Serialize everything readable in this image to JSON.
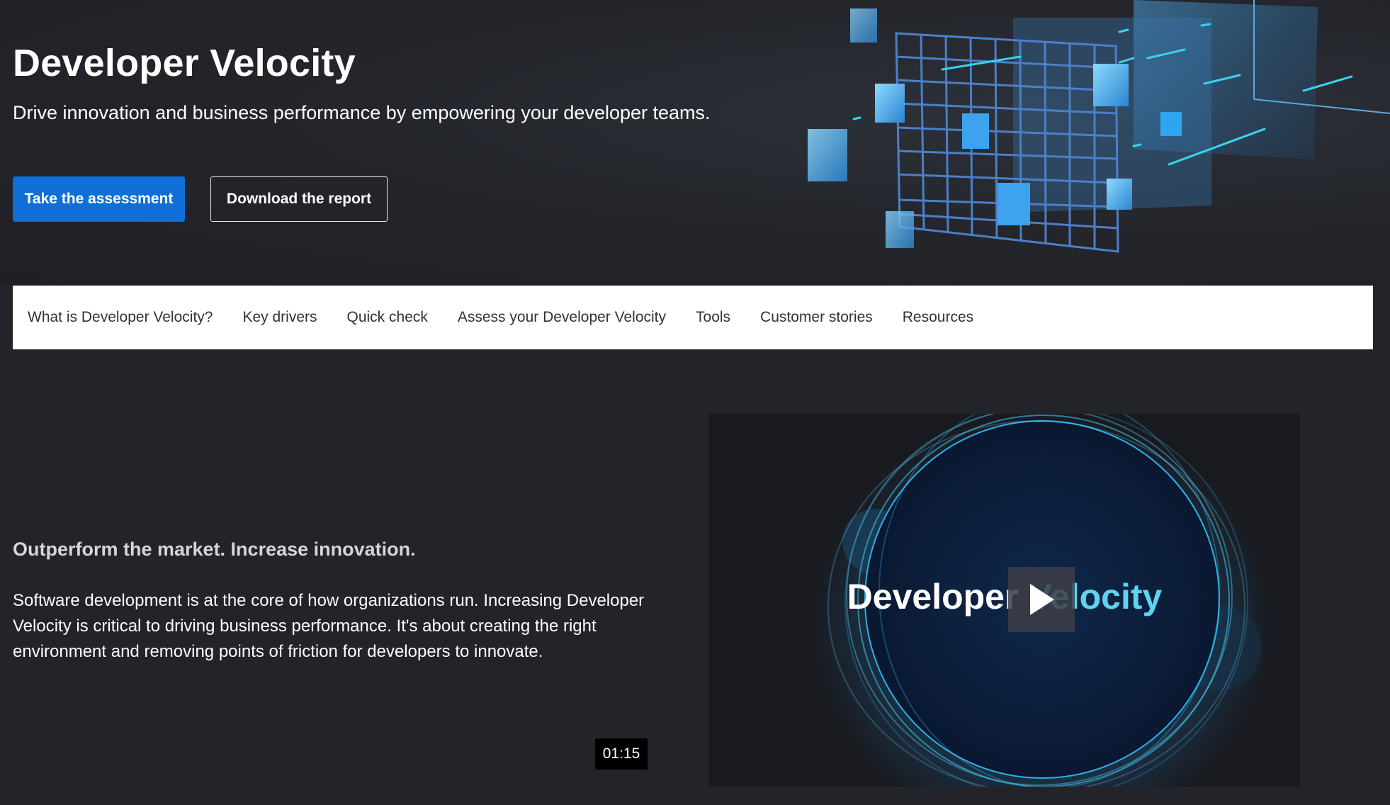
{
  "hero": {
    "title": "Developer Velocity",
    "subtitle": "Drive innovation and business performance by empowering your developer teams.",
    "primary_button": "Take the assessment",
    "secondary_button": "Download the report"
  },
  "nav": {
    "items": [
      "What is Developer Velocity?",
      "Key drivers",
      "Quick check",
      "Assess your Developer Velocity",
      "Tools",
      "Customer stories",
      "Resources"
    ]
  },
  "section": {
    "heading": "Outperform the market. Increase innovation.",
    "body": "Software development is at the core of how organizations run. Increasing Developer Velocity is critical to driving business performance. It's about creating the right environment and removing points of friction for developers to innovate."
  },
  "video": {
    "title_word_1": "Developer",
    "title_word_2": "Velocity",
    "duration": "01:15",
    "play_icon": "play-icon"
  },
  "colors": {
    "primary_button": "#0f6fd6",
    "page_background": "#232429",
    "nav_background": "#ffffff",
    "accent_cyan": "#5fd3f0"
  }
}
